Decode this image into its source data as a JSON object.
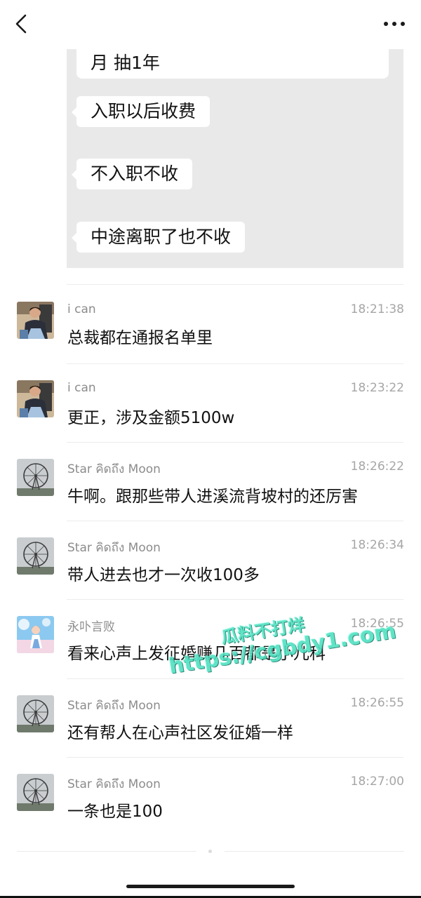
{
  "header": {
    "back_icon": "chevron-left-icon",
    "more_icon": "more-dots-icon"
  },
  "quoted_chat": {
    "bubbles": [
      "月  抽1年",
      "入职以后收费",
      "不入职不收",
      "中途离职了也不收"
    ]
  },
  "messages": [
    {
      "sender": "i can",
      "time": "18:21:38",
      "text": "总裁都在通报名单里",
      "avatar": "man-photo-avatar"
    },
    {
      "sender": "i can",
      "time": "18:23:22",
      "text": "更正，涉及金额5100w",
      "avatar": "man-photo-avatar"
    },
    {
      "sender": "Star คิดถึง Moon",
      "time": "18:26:22",
      "text": "牛啊。跟那些带人进溪流背坡村的还厉害",
      "avatar": "ferris-wheel-avatar"
    },
    {
      "sender": "Star คิดถึง Moon",
      "time": "18:26:34",
      "text": "带人进去也才一次收100多",
      "avatar": "ferris-wheel-avatar"
    },
    {
      "sender": "永卟言败",
      "time": "18:26:55",
      "text": "看来心声上发征婚赚几百都是小儿科",
      "avatar": "anime-avatar"
    },
    {
      "sender": "Star คิดถึง Moon",
      "time": "18:26:55",
      "text": "还有帮人在心声社区发征婚一样",
      "avatar": "ferris-wheel-avatar"
    },
    {
      "sender": "Star คิดถึง Moon",
      "time": "18:27:00",
      "text": "一条也是100",
      "avatar": "ferris-wheel-avatar"
    }
  ],
  "watermark": {
    "line1": "瓜料不打烊",
    "line2": "https://cgbdy1.com"
  },
  "colors": {
    "quote_bg": "#e9e9e9",
    "meta_text": "#8c8c8c",
    "watermark": "#4fe0c0"
  }
}
